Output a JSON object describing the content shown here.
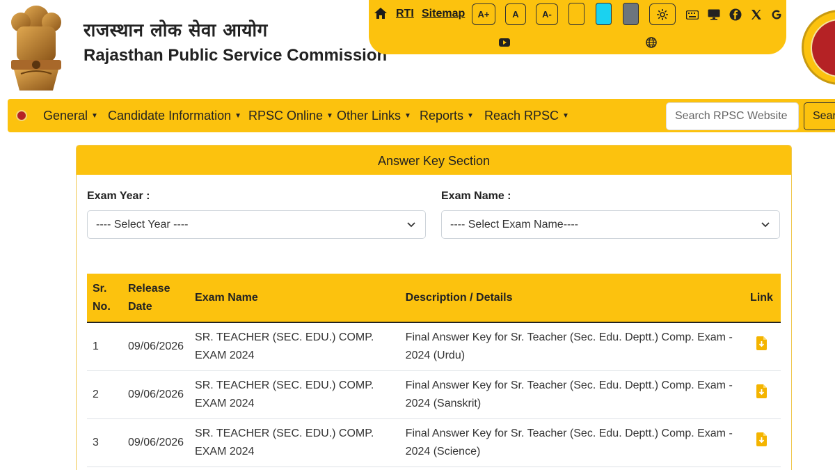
{
  "header": {
    "title_hindi": "राजस्थान लोक सेवा आयोग",
    "title_english": "Rajasthan Public Service Commission"
  },
  "utility_bar": {
    "home_icon": "home-icon",
    "rti_label": "RTI",
    "sitemap_label": "Sitemap",
    "font_increase_label": "A+",
    "font_normal_label": "A",
    "font_decrease_label": "A-",
    "theme_swatches": [
      {
        "name": "default-theme",
        "color": "#fcc20e"
      },
      {
        "name": "cyan-theme",
        "color": "#1ad2f0"
      },
      {
        "name": "grey-theme",
        "color": "#6c757d"
      }
    ],
    "icons": [
      "settings-icon",
      "keyboard-icon",
      "monitor-icon",
      "facebook-icon",
      "x-icon",
      "google-icon",
      "youtube-icon",
      "globe-icon"
    ]
  },
  "nav": {
    "items": [
      {
        "label": "General"
      },
      {
        "label": "Candidate Information"
      },
      {
        "label": "RPSC Online"
      },
      {
        "label": "Other Links"
      },
      {
        "label": "Reports"
      },
      {
        "label": "Reach RPSC"
      }
    ],
    "search_placeholder": "Search RPSC Website",
    "search_button": "Search"
  },
  "answer_key": {
    "section_title": "Answer Key Section",
    "exam_year_label": "Exam Year :",
    "exam_year_value": "---- Select Year ----",
    "exam_name_label": "Exam Name :",
    "exam_name_value": "---- Select Exam Name----",
    "columns": [
      "Sr. No.",
      "Release Date",
      "Exam Name",
      "Description / Details",
      "Link"
    ],
    "rows": [
      {
        "sr": "1",
        "date": "09/06/2026",
        "exam": "SR. TEACHER (SEC. EDU.) COMP. EXAM 2024",
        "description": "Final Answer Key for Sr. Teacher (Sec. Edu. Deptt.) Comp. Exam - 2024 (Urdu)",
        "link_icon": "download-file-icon"
      },
      {
        "sr": "2",
        "date": "09/06/2026",
        "exam": "SR. TEACHER (SEC. EDU.) COMP. EXAM 2024",
        "description": "Final Answer Key for Sr. Teacher (Sec. Edu. Deptt.) Comp. Exam - 2024 (Sanskrit)",
        "link_icon": "download-file-icon"
      },
      {
        "sr": "3",
        "date": "09/06/2026",
        "exam": "SR. TEACHER (SEC. EDU.) COMP. EXAM 2024",
        "description": "Final Answer Key for Sr. Teacher (Sec. Edu. Deptt.) Comp. Exam - 2024 (Science)",
        "link_icon": "download-file-icon"
      }
    ]
  },
  "colors": {
    "accent": "#fcc20e",
    "download_icon": "#f4b400"
  }
}
